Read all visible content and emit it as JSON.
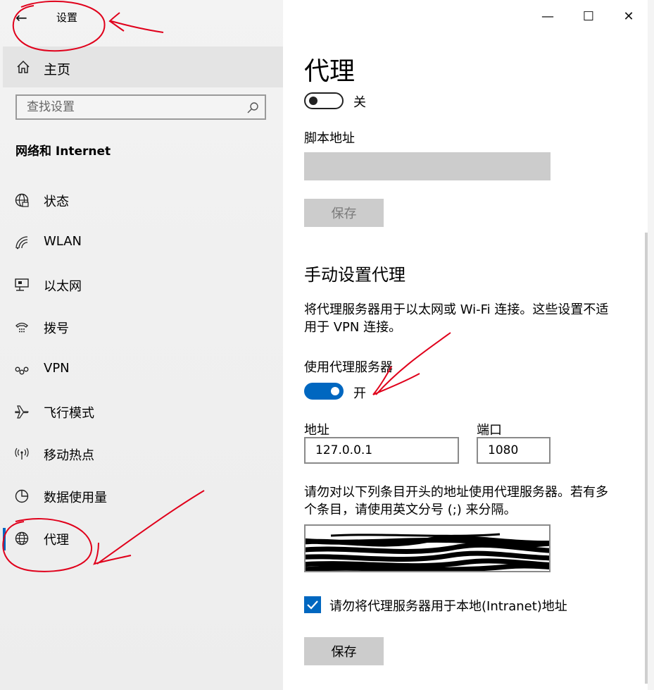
{
  "window": {
    "title": "设置",
    "back_glyph": "←",
    "minimize_glyph": "—",
    "maximize_glyph": "☐",
    "close_glyph": "✕"
  },
  "sidebar": {
    "home_label": "主页",
    "search_placeholder": "查找设置",
    "section_title": "网络和 Internet",
    "items": [
      {
        "label": "状态",
        "icon": "globe-status-icon"
      },
      {
        "label": "WLAN",
        "icon": "wifi-icon"
      },
      {
        "label": "以太网",
        "icon": "ethernet-icon"
      },
      {
        "label": "拨号",
        "icon": "dialup-icon"
      },
      {
        "label": "VPN",
        "icon": "vpn-icon"
      },
      {
        "label": "飞行模式",
        "icon": "airplane-icon"
      },
      {
        "label": "移动热点",
        "icon": "hotspot-icon"
      },
      {
        "label": "数据使用量",
        "icon": "data-usage-icon"
      },
      {
        "label": "代理",
        "icon": "globe-icon"
      }
    ],
    "active_item": "代理"
  },
  "main": {
    "page_title": "代理",
    "auto_toggle_state": "关",
    "script_address_label": "脚本地址",
    "script_save_label": "保存",
    "manual_heading": "手动设置代理",
    "manual_desc_line1": "将代理服务器用于以太网或 Wi-Fi 连接。这些设置不适",
    "manual_desc_line2": "用于 VPN 连接。",
    "use_proxy_label": "使用代理服务器",
    "use_proxy_state": "开",
    "address_label": "地址",
    "address_value": "127.0.0.1",
    "port_label": "端口",
    "port_value": "1080",
    "exceptions_line1": "请勿对以下列条目开头的地址使用代理服务器。若有多",
    "exceptions_line2": "个条目，请使用英文分号 (;) 来分隔。",
    "bypass_local_label": "请勿将代理服务器用于本地(Intranet)地址",
    "bypass_local_checked": true,
    "save_label": "保存"
  },
  "colors": {
    "accent": "#0067c0",
    "annotation": "#e0001b"
  }
}
